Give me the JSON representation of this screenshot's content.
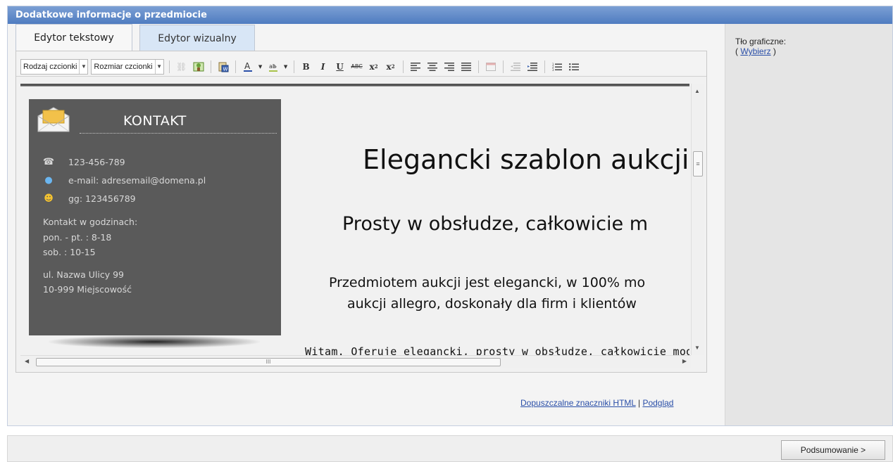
{
  "panel": {
    "title": "Dodatkowe informacje o przedmiocie"
  },
  "tabs": [
    {
      "label": "Edytor tekstowy",
      "active": true
    },
    {
      "label": "Edytor wizualny",
      "active": false
    }
  ],
  "toolbar": {
    "font_family_label": "Rodzaj czcionki",
    "font_size_label": "Rozmiar czcionki",
    "buttons": [
      "link-icon",
      "image-icon",
      "paste-word-icon",
      "font-color-icon",
      "highlight-icon",
      "bold-icon",
      "italic-icon",
      "underline-icon",
      "strikethrough-icon",
      "subscript-icon",
      "superscript-icon",
      "align-left-icon",
      "align-center-icon",
      "align-right-icon",
      "justify-icon",
      "table-icon",
      "outdent-icon",
      "indent-icon",
      "ordered-list-icon",
      "unordered-list-icon"
    ]
  },
  "content": {
    "contact": {
      "title": "KONTAKT",
      "phone": "123-456-789",
      "email": "e-mail: adresemail@domena.pl",
      "gg": "gg: 123456789",
      "hours_label": "Kontakt w godzinach:",
      "hours_weekday": "pon. - pt. : 8-18",
      "hours_saturday": "sob. : 10-15",
      "street": "ul. Nazwa Ulicy 99",
      "city": "10-999 Miejscowość"
    },
    "heading1": "Elegancki szablon aukcji",
    "heading2": "Prosty w obsłudze, całkowicie m",
    "heading3_line1": "Przedmiotem aukcji jest elegancki, w 100% mo",
    "heading3_line2": "aukcji allegro, doskonały dla firm i klientów",
    "paragraph": "Witam. Oferuje elegancki, prosty w obsłudze, całkowicie modyfi"
  },
  "links": {
    "allowed_html": "Dopuszczalne znaczniki HTML",
    "separator": "|",
    "preview": "Podgląd"
  },
  "sidebar": {
    "background_label": "Tło graficzne:",
    "open_paren": "(",
    "choose_link": "Wybierz",
    "close_paren": ")"
  },
  "footer": {
    "summary_button": "Podsumowanie >"
  },
  "colors": {
    "header_blue": "#5a86c7",
    "contact_box": "#5a5a5a",
    "link": "#2a4fa8"
  }
}
